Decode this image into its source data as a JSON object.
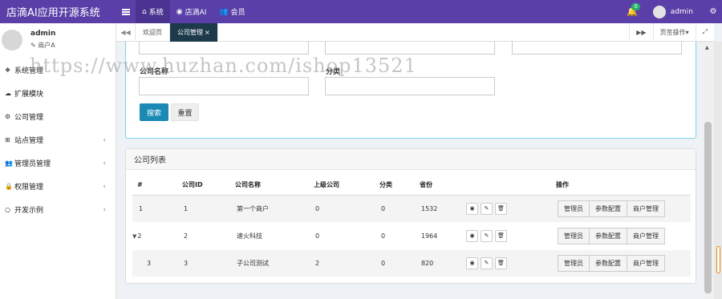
{
  "app": {
    "title": "店滴AI应用开源系统"
  },
  "topnav": [
    {
      "icon": "home-icon",
      "label": "系统"
    },
    {
      "icon": "eye-icon",
      "label": "店滴AI"
    },
    {
      "icon": "user-plus-icon",
      "label": "会员"
    }
  ],
  "header": {
    "notification_count": "0",
    "username": "admin"
  },
  "sidebar": {
    "username": "admin",
    "role": "商户A",
    "items": [
      {
        "label": "系统管理",
        "icon": "cubes-icon",
        "has_children": false
      },
      {
        "label": "扩展模块",
        "icon": "cloud-upload-icon",
        "has_children": false
      },
      {
        "label": "公司管理",
        "icon": "gears-icon",
        "has_children": false
      },
      {
        "label": "站点管理",
        "icon": "sitemap-icon",
        "has_children": true
      },
      {
        "label": "管理员管理",
        "icon": "users-icon",
        "has_children": true
      },
      {
        "label": "权限管理",
        "icon": "lock-icon",
        "has_children": true
      },
      {
        "label": "开发示例",
        "icon": "circle-icon",
        "has_children": true
      }
    ]
  },
  "tabs": {
    "items": [
      {
        "label": "欢迎页",
        "active": false
      },
      {
        "label": "公司管理",
        "active": true
      }
    ],
    "tab_ops_label": "页签操作"
  },
  "search": {
    "fields": [
      {
        "label": "公司名称",
        "value": ""
      },
      {
        "label": "分类",
        "value": ""
      }
    ],
    "search_button": "搜索",
    "reset_button": "重置"
  },
  "company_list": {
    "title": "公司列表",
    "columns": [
      "#",
      "公司ID",
      "公司名称",
      "上级公司",
      "分类",
      "省份",
      "",
      "操作"
    ],
    "rows": [
      {
        "index": "1",
        "id": "1",
        "name": "第一个商户",
        "parent": "0",
        "category": "0",
        "province": "1532",
        "expandable": false
      },
      {
        "index": "2",
        "id": "2",
        "name": "速火科技",
        "parent": "0",
        "category": "0",
        "province": "1964",
        "expandable": true
      },
      {
        "index": "3",
        "id": "3",
        "name": "子公司测试",
        "parent": "2",
        "category": "0",
        "province": "820",
        "expandable": false
      }
    ],
    "actions": [
      "管理员",
      "参数配置",
      "商户管理"
    ]
  },
  "watermark": "https://www.huzhan.com/ishop13521",
  "colors": {
    "topbar": "#5a3fa8",
    "active_tab": "#1d3a4a",
    "search_button": "#1a8ab4"
  }
}
